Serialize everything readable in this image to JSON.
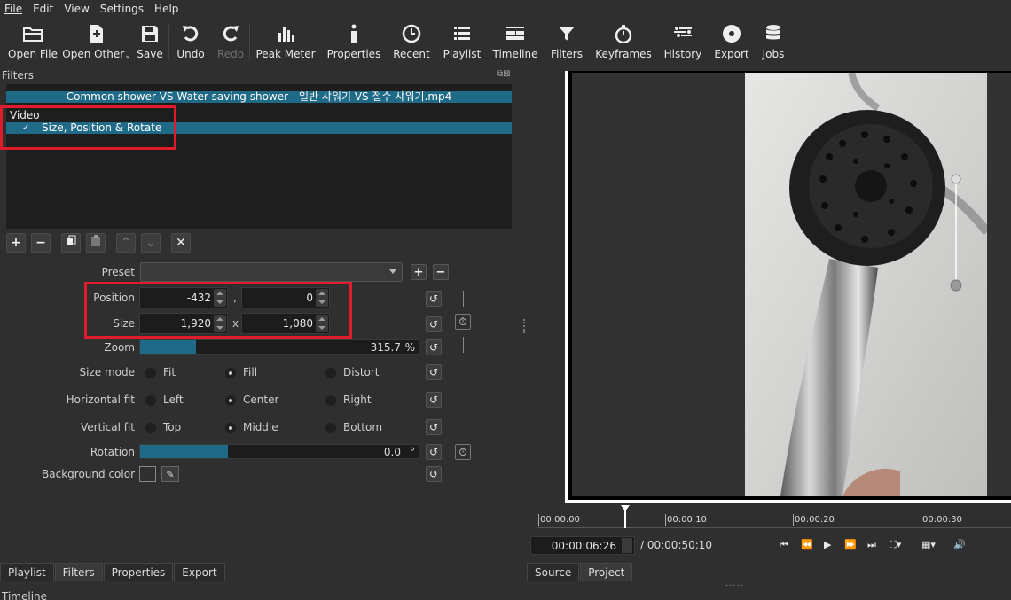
{
  "menu": [
    "File",
    "Edit",
    "View",
    "Settings",
    "Help"
  ],
  "toolbar": {
    "open_file": "Open File",
    "open_other": "Open Other",
    "save": "Save",
    "undo": "Undo",
    "redo": "Redo",
    "peak_meter": "Peak Meter",
    "properties": "Properties",
    "recent": "Recent",
    "playlist": "Playlist",
    "timeline": "Timeline",
    "filters": "Filters",
    "keyframes": "Keyframes",
    "history": "History",
    "export": "Export",
    "jobs": "Jobs"
  },
  "filters_panel": {
    "title": "Filters",
    "file_name": "Common shower VS Water saving shower - 일반 샤워기 VS 절수 샤워기.mp4",
    "group": "Video",
    "filter_name": "Size, Position & Rotate",
    "check": "✓"
  },
  "props": {
    "preset_label": "Preset",
    "preset_value": "",
    "position_label": "Position",
    "position_x": "-432",
    "position_y": "0",
    "comma": ",",
    "size_label": "Size",
    "size_w": "1,920",
    "size_h": "1,080",
    "x_sep": "x",
    "zoom_label": "Zoom",
    "zoom_value": "315.7",
    "zoom_unit": "%",
    "zoom_fraction": 0.2,
    "size_mode_label": "Size mode",
    "size_mode_opts": [
      "Fit",
      "Fill",
      "Distort"
    ],
    "size_mode_selected": "Fill",
    "hfit_label": "Horizontal fit",
    "hfit_opts": [
      "Left",
      "Center",
      "Right"
    ],
    "hfit_selected": "Center",
    "vfit_label": "Vertical fit",
    "vfit_opts": [
      "Top",
      "Middle",
      "Bottom"
    ],
    "vfit_selected": "Middle",
    "rotation_label": "Rotation",
    "rotation_value": "0.0",
    "rotation_unit": "°",
    "rotation_fraction": 0.5,
    "bg_label": "Background color"
  },
  "tabs_left": [
    "Playlist",
    "Filters",
    "Properties",
    "Export"
  ],
  "tabs_left_active": "Filters",
  "tabs_right": [
    "Source",
    "Project"
  ],
  "timeline_title": "Timeline",
  "ruler": [
    "00:00:00",
    "00:00:10",
    "00:00:20",
    "00:00:30"
  ],
  "transport": {
    "timecode": "00:00:06:26",
    "duration": "/ 00:00:50:10"
  },
  "colors": {
    "accent": "#1f6a87",
    "highlight_box": "#e01b2b"
  }
}
